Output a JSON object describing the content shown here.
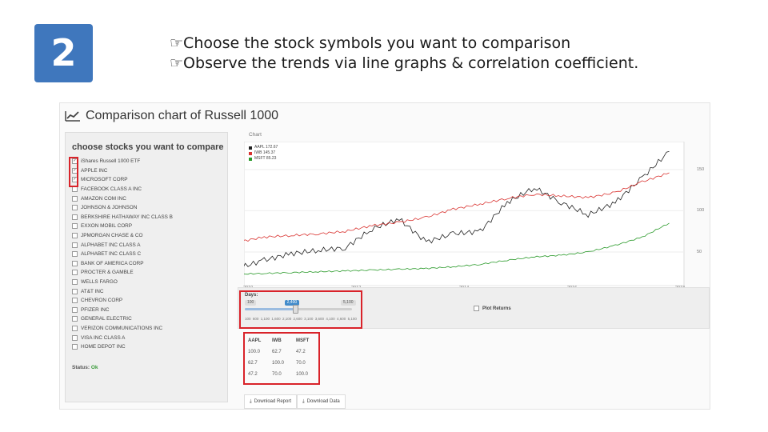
{
  "slide": {
    "step_number": "2",
    "bullets": [
      "Choose the stock symbols you want to comparison",
      "Observe the trends via line graphs & correlation coefficient."
    ],
    "bullet_icon": "pointing-hand-icon"
  },
  "app": {
    "title": "Comparison chart of Russell 1000",
    "title_icon": "line-chart-icon",
    "sidebar": {
      "heading": "choose stocks you want to compare",
      "stocks": [
        {
          "label": "iShares Russell 1000 ETF",
          "checked": true
        },
        {
          "label": "APPLE INC",
          "checked": true
        },
        {
          "label": "MICROSOFT CORP",
          "checked": true
        },
        {
          "label": "FACEBOOK CLASS A INC",
          "checked": false
        },
        {
          "label": "AMAZON COM INC",
          "checked": false
        },
        {
          "label": "JOHNSON & JOHNSON",
          "checked": false
        },
        {
          "label": "BERKSHIRE HATHAWAY INC CLASS B",
          "checked": false
        },
        {
          "label": "EXXON MOBIL CORP",
          "checked": false
        },
        {
          "label": "JPMORGAN CHASE & CO",
          "checked": false
        },
        {
          "label": "ALPHABET INC CLASS A",
          "checked": false
        },
        {
          "label": "ALPHABET INC CLASS C",
          "checked": false
        },
        {
          "label": "BANK OF AMERICA CORP",
          "checked": false
        },
        {
          "label": "PROCTER & GAMBLE",
          "checked": false
        },
        {
          "label": "WELLS FARGO",
          "checked": false
        },
        {
          "label": "AT&T INC",
          "checked": false
        },
        {
          "label": "CHEVRON CORP",
          "checked": false
        },
        {
          "label": "PFIZER INC",
          "checked": false
        },
        {
          "label": "GENERAL ELECTRIC",
          "checked": false
        },
        {
          "label": "VERIZON COMMUNICATIONS INC",
          "checked": false
        },
        {
          "label": "VISA INC CLASS A",
          "checked": false
        },
        {
          "label": "HOME DEPOT INC",
          "checked": false
        }
      ],
      "status_label": "Status:",
      "status_value": "Ok"
    },
    "chart_panel_label": "Chart",
    "days": {
      "label": "Days:",
      "min_value": "100",
      "selected_value": "2,400",
      "max_value": "5,100",
      "ticks": [
        "100",
        "600",
        "1,100",
        "1,600",
        "2,100",
        "2,600",
        "3,100",
        "3,600",
        "4,100",
        "4,600",
        "5,100"
      ],
      "level_fraction": 0.46
    },
    "plot_returns_label": "Plot Returns",
    "correlation": {
      "headers": [
        "AAPL",
        "IWB",
        "MSFT"
      ],
      "rows": [
        [
          "100.0",
          "62.7",
          "47.2"
        ],
        [
          "62.7",
          "100.0",
          "70.0"
        ],
        [
          "47.2",
          "70.0",
          "100.0"
        ]
      ]
    },
    "buttons": {
      "download_report": "Download Report",
      "download_data": "Download Data"
    }
  },
  "chart_data": {
    "type": "line",
    "title": "",
    "x_ticks": [
      "2010",
      "2012",
      "2014",
      "2016",
      "2018"
    ],
    "y_ticks": [
      50,
      100,
      150
    ],
    "xlim": [
      2010,
      2018
    ],
    "ylim": [
      15,
      180
    ],
    "series": [
      {
        "name": "AAPL 172.67",
        "color": "#222222",
        "x": [
          2009.3,
          2009.8,
          2010.3,
          2010.8,
          2011.3,
          2011.8,
          2012.3,
          2012.8,
          2013.3,
          2013.8,
          2014.3,
          2014.8,
          2015.3,
          2015.8,
          2016.3,
          2016.8,
          2017.3,
          2017.8
        ],
        "y": [
          25,
          30,
          40,
          48,
          52,
          55,
          78,
          90,
          62,
          72,
          75,
          110,
          128,
          110,
          95,
          110,
          140,
          172
        ]
      },
      {
        "name": "IWB 145.37",
        "color": "#d9322f",
        "x": [
          2009.3,
          2009.8,
          2010.3,
          2010.8,
          2011.3,
          2011.8,
          2012.3,
          2012.8,
          2013.3,
          2013.8,
          2014.3,
          2014.8,
          2015.3,
          2015.8,
          2016.3,
          2016.8,
          2017.3,
          2017.8
        ],
        "y": [
          58,
          62,
          68,
          70,
          72,
          75,
          82,
          86,
          92,
          102,
          108,
          115,
          120,
          118,
          116,
          122,
          135,
          146
        ]
      },
      {
        "name": "MSFT 85.23",
        "color": "#2a9a2a",
        "x": [
          2009.3,
          2009.8,
          2010.3,
          2010.8,
          2011.3,
          2011.8,
          2012.3,
          2012.8,
          2013.3,
          2013.8,
          2014.3,
          2014.8,
          2015.3,
          2015.8,
          2016.3,
          2016.8,
          2017.3,
          2017.8
        ],
        "y": [
          22,
          23,
          24,
          25,
          26,
          27,
          28,
          29,
          30,
          32,
          35,
          40,
          44,
          46,
          50,
          58,
          68,
          85
        ]
      }
    ]
  }
}
